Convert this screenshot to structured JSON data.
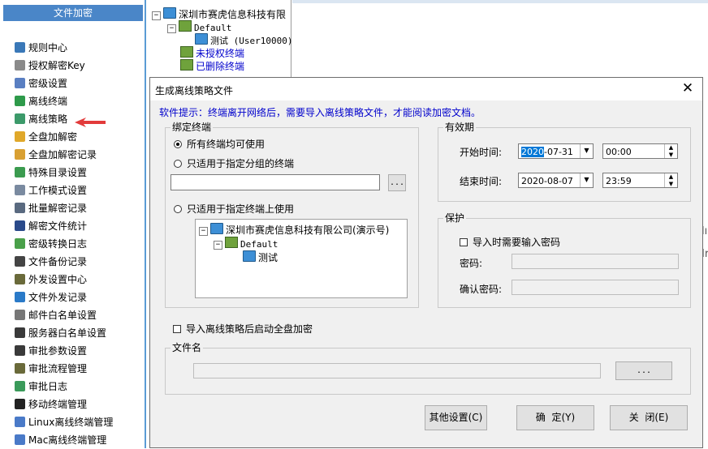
{
  "left_panel": {
    "header": "文件加密",
    "items": [
      {
        "label": "规则中心",
        "icon": "rules-icon",
        "color": "#3a78b8"
      },
      {
        "label": "授权解密Key",
        "icon": "key-lock-icon",
        "color": "#8a8a8a"
      },
      {
        "label": "密级设置",
        "icon": "shield-gear-icon",
        "color": "#5a7fc2"
      },
      {
        "label": "离线终端",
        "icon": "offline-terminal-icon",
        "color": "#2e9a4a"
      },
      {
        "label": "离线策略",
        "icon": "offline-policy-icon",
        "color": "#3c9a6a"
      },
      {
        "label": "全盘加解密",
        "icon": "disk-encrypt-icon",
        "color": "#e0a82a"
      },
      {
        "label": "全盘加解密记录",
        "icon": "disk-log-icon",
        "color": "#d9a032"
      },
      {
        "label": "特殊目录设置",
        "icon": "special-folder-icon",
        "color": "#3b9b4f"
      },
      {
        "label": "工作模式设置",
        "icon": "work-mode-icon",
        "color": "#7a8aa0"
      },
      {
        "label": "批量解密记录",
        "icon": "batch-decrypt-icon",
        "color": "#5a6a80"
      },
      {
        "label": "解密文件统计",
        "icon": "bar-chart-icon",
        "color": "#2a4a8a"
      },
      {
        "label": "密级转换日志",
        "icon": "level-log-icon",
        "color": "#4aa04a"
      },
      {
        "label": "文件备份记录",
        "icon": "backup-icon",
        "color": "#444444"
      },
      {
        "label": "外发设置中心",
        "icon": "outgoing-settings-icon",
        "color": "#6a6a3a"
      },
      {
        "label": "文件外发记录",
        "icon": "outgoing-log-icon",
        "color": "#2a7ac8"
      },
      {
        "label": "邮件白名单设置",
        "icon": "mail-whitelist-icon",
        "color": "#777777"
      },
      {
        "label": "服务器白名单设置",
        "icon": "server-whitelist-icon",
        "color": "#3a3a3a"
      },
      {
        "label": "审批参数设置",
        "icon": "approval-params-icon",
        "color": "#3a3a3a"
      },
      {
        "label": "审批流程管理",
        "icon": "approval-flow-icon",
        "color": "#6a6a3a"
      },
      {
        "label": "审批日志",
        "icon": "approval-log-icon",
        "color": "#3a9a5a"
      },
      {
        "label": "移动终端管理",
        "icon": "mobile-terminal-icon",
        "color": "#222222"
      },
      {
        "label": "Linux离线终端管理",
        "icon": "linux-terminal-icon",
        "color": "#4a7ac8"
      },
      {
        "label": "Mac离线终端管理",
        "icon": "mac-terminal-icon",
        "color": "#4a7ac8"
      }
    ]
  },
  "background_tree": {
    "root": "深圳市赛虎信息科技有限",
    "group": "Default",
    "terminal": "测试 (User10000)",
    "unauthorized": "未授权终端",
    "deleted": "已删除终端"
  },
  "side_glyphs": [
    "lı",
    "Ir"
  ],
  "dialog": {
    "title": "生成离线策略文件",
    "close_symbol": "✕",
    "hint": "软件提示：终端离开网络后，需要导入离线策略文件，才能阅读加密文档。",
    "bind_group": {
      "label": "绑定终端",
      "option_all": "所有终端均可使用",
      "option_group": "只适用于指定分组的终端",
      "group_value": "",
      "browse": "...",
      "option_terminal": "只适用于指定终端上使用",
      "tree_root": "深圳市赛虎信息科技有限公司(演示号)",
      "tree_group": "Default",
      "tree_terminal": "测试"
    },
    "validity": {
      "label": "有效期",
      "start_label": "开始时间:",
      "start_year": "2020",
      "start_rest": "-07-31",
      "start_time": "00:00",
      "end_label": "结束时间:",
      "end_date": "2020-08-07",
      "end_time": "23:59"
    },
    "protect": {
      "label": "保护",
      "require_password": "导入时需要输入密码",
      "password_label": "密码:",
      "password_value": "",
      "confirm_label": "确认密码:",
      "confirm_value": ""
    },
    "full_disk": "导入离线策略后启动全盘加密",
    "filename": {
      "label": "文件名",
      "value": "",
      "browse": "..."
    },
    "buttons": {
      "other": "其他设置(C)",
      "ok": "确  定(Y)",
      "close": "关  闭(E)"
    }
  }
}
